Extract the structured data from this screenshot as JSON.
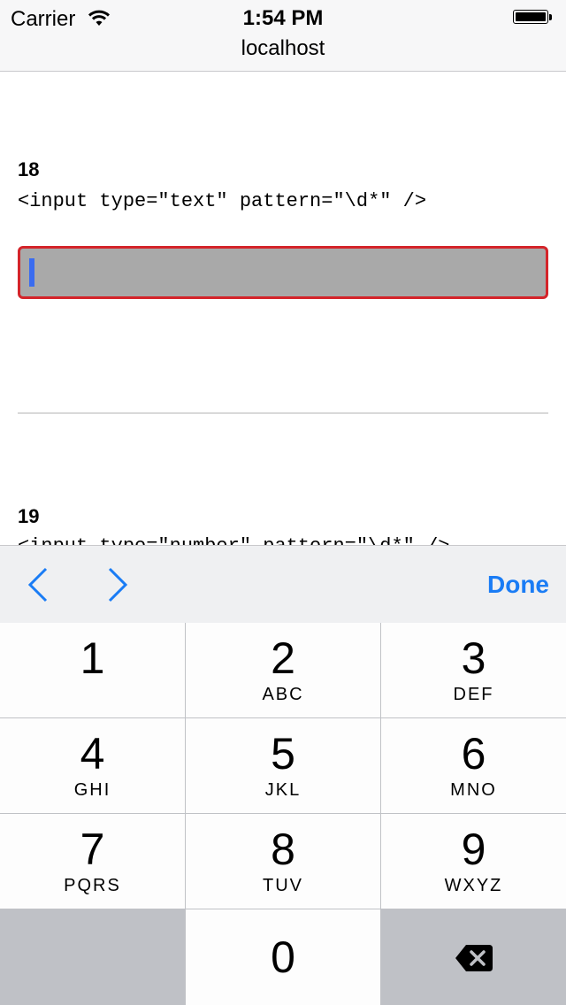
{
  "status_bar": {
    "carrier": "Carrier",
    "time": "1:54 PM"
  },
  "browser": {
    "url": "localhost"
  },
  "content": {
    "example_18": {
      "number": "18",
      "code": "<input type=\"text\" pattern=\"\\d*\" />"
    },
    "example_19": {
      "number": "19",
      "code": "<input type=\"number\" pattern=\"\\d*\" />"
    }
  },
  "accessory_bar": {
    "done_label": "Done"
  },
  "keypad": {
    "keys": [
      {
        "digit": "1",
        "letters": ""
      },
      {
        "digit": "2",
        "letters": "ABC"
      },
      {
        "digit": "3",
        "letters": "DEF"
      },
      {
        "digit": "4",
        "letters": "GHI"
      },
      {
        "digit": "5",
        "letters": "JKL"
      },
      {
        "digit": "6",
        "letters": "MNO"
      },
      {
        "digit": "7",
        "letters": "PQRS"
      },
      {
        "digit": "8",
        "letters": "TUV"
      },
      {
        "digit": "9",
        "letters": "WXYZ"
      },
      {
        "digit": "0",
        "letters": ""
      }
    ]
  },
  "colors": {
    "accent": "#1a7cf5",
    "field_border": "#d4242a",
    "field_bg": "#a9a9a9",
    "caret": "#3a6cf0"
  }
}
